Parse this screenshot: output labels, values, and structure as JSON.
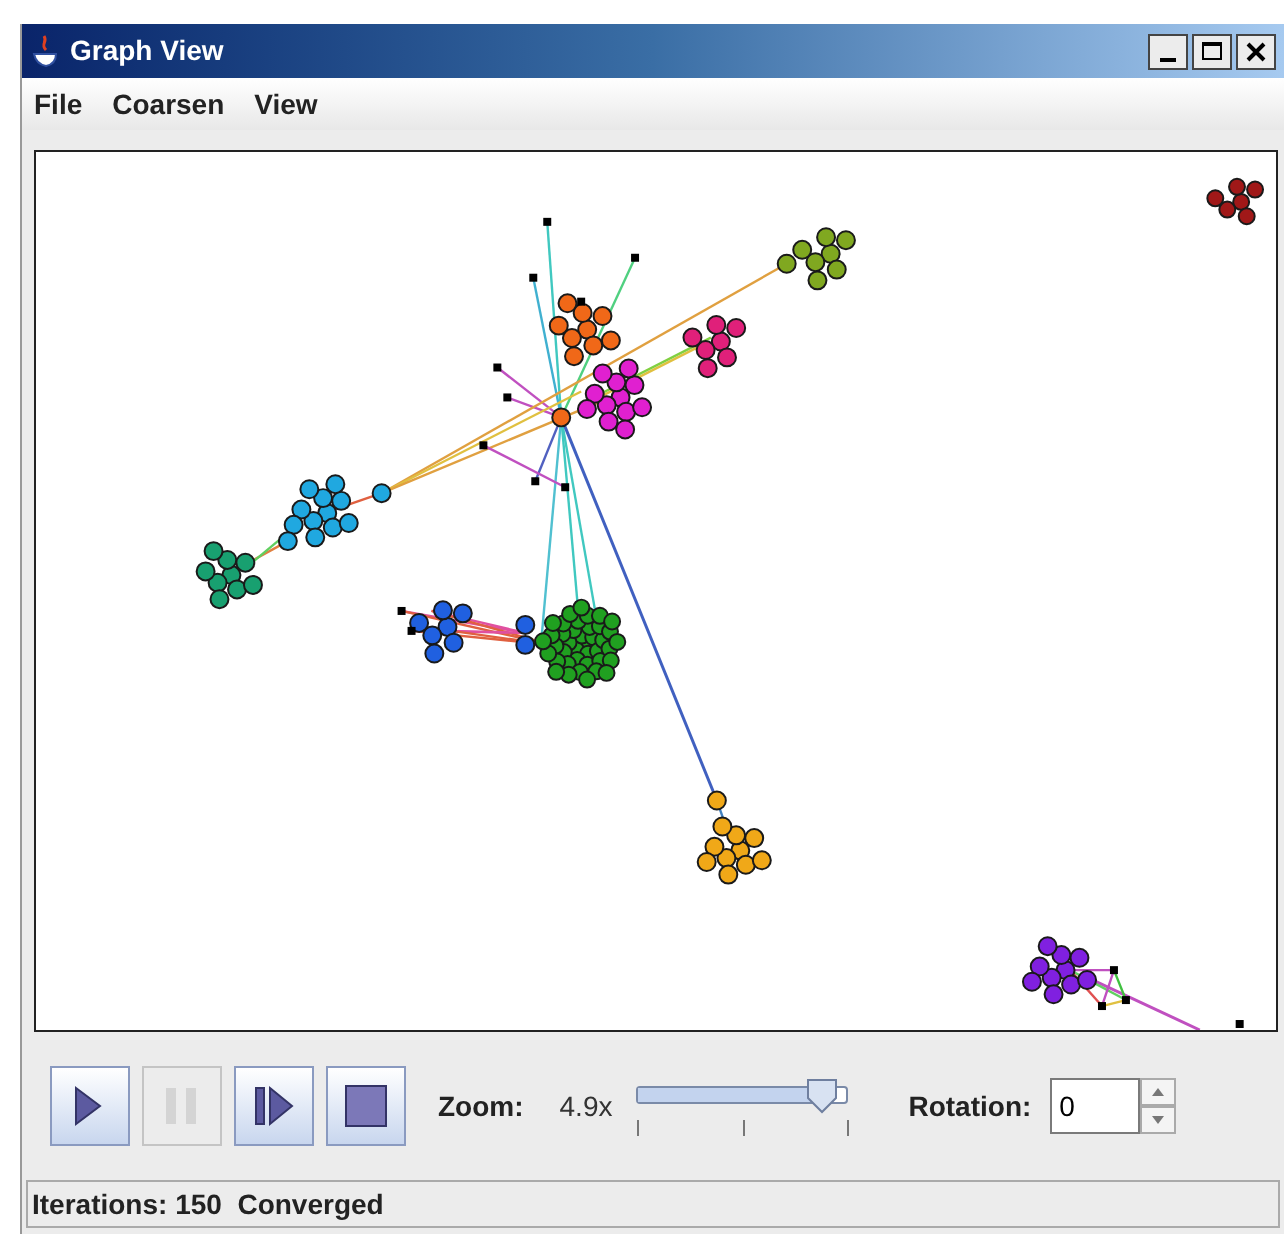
{
  "window": {
    "title": "Graph View"
  },
  "menu": [
    "File",
    "Coarsen",
    "View"
  ],
  "controls": {
    "buttons": [
      {
        "kind": "play",
        "disabled": false
      },
      {
        "kind": "pause",
        "disabled": true
      },
      {
        "kind": "step",
        "disabled": false
      },
      {
        "kind": "stop",
        "disabled": false
      }
    ],
    "zoom": {
      "label": "Zoom:",
      "reading": "4.9x",
      "level": 0.87
    },
    "rotation": {
      "label": "Rotation:",
      "value": "0"
    }
  },
  "status_bar": "Iterations: 150  Converged"
}
